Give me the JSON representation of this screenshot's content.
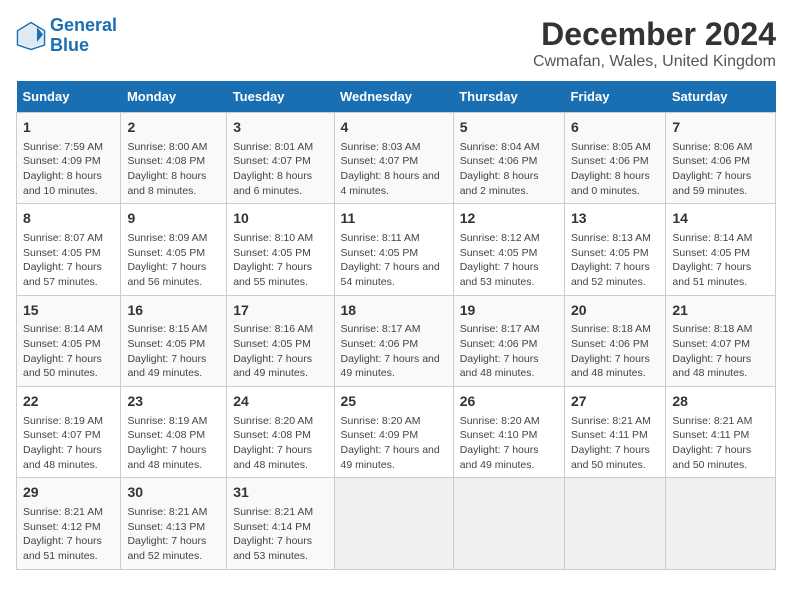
{
  "logo": {
    "line1": "General",
    "line2": "Blue"
  },
  "title": "December 2024",
  "subtitle": "Cwmafan, Wales, United Kingdom",
  "days_of_week": [
    "Sunday",
    "Monday",
    "Tuesday",
    "Wednesday",
    "Thursday",
    "Friday",
    "Saturday"
  ],
  "weeks": [
    [
      {
        "day": "1",
        "sunrise": "Sunrise: 7:59 AM",
        "sunset": "Sunset: 4:09 PM",
        "daylight": "Daylight: 8 hours and 10 minutes."
      },
      {
        "day": "2",
        "sunrise": "Sunrise: 8:00 AM",
        "sunset": "Sunset: 4:08 PM",
        "daylight": "Daylight: 8 hours and 8 minutes."
      },
      {
        "day": "3",
        "sunrise": "Sunrise: 8:01 AM",
        "sunset": "Sunset: 4:07 PM",
        "daylight": "Daylight: 8 hours and 6 minutes."
      },
      {
        "day": "4",
        "sunrise": "Sunrise: 8:03 AM",
        "sunset": "Sunset: 4:07 PM",
        "daylight": "Daylight: 8 hours and 4 minutes."
      },
      {
        "day": "5",
        "sunrise": "Sunrise: 8:04 AM",
        "sunset": "Sunset: 4:06 PM",
        "daylight": "Daylight: 8 hours and 2 minutes."
      },
      {
        "day": "6",
        "sunrise": "Sunrise: 8:05 AM",
        "sunset": "Sunset: 4:06 PM",
        "daylight": "Daylight: 8 hours and 0 minutes."
      },
      {
        "day": "7",
        "sunrise": "Sunrise: 8:06 AM",
        "sunset": "Sunset: 4:06 PM",
        "daylight": "Daylight: 7 hours and 59 minutes."
      }
    ],
    [
      {
        "day": "8",
        "sunrise": "Sunrise: 8:07 AM",
        "sunset": "Sunset: 4:05 PM",
        "daylight": "Daylight: 7 hours and 57 minutes."
      },
      {
        "day": "9",
        "sunrise": "Sunrise: 8:09 AM",
        "sunset": "Sunset: 4:05 PM",
        "daylight": "Daylight: 7 hours and 56 minutes."
      },
      {
        "day": "10",
        "sunrise": "Sunrise: 8:10 AM",
        "sunset": "Sunset: 4:05 PM",
        "daylight": "Daylight: 7 hours and 55 minutes."
      },
      {
        "day": "11",
        "sunrise": "Sunrise: 8:11 AM",
        "sunset": "Sunset: 4:05 PM",
        "daylight": "Daylight: 7 hours and 54 minutes."
      },
      {
        "day": "12",
        "sunrise": "Sunrise: 8:12 AM",
        "sunset": "Sunset: 4:05 PM",
        "daylight": "Daylight: 7 hours and 53 minutes."
      },
      {
        "day": "13",
        "sunrise": "Sunrise: 8:13 AM",
        "sunset": "Sunset: 4:05 PM",
        "daylight": "Daylight: 7 hours and 52 minutes."
      },
      {
        "day": "14",
        "sunrise": "Sunrise: 8:14 AM",
        "sunset": "Sunset: 4:05 PM",
        "daylight": "Daylight: 7 hours and 51 minutes."
      }
    ],
    [
      {
        "day": "15",
        "sunrise": "Sunrise: 8:14 AM",
        "sunset": "Sunset: 4:05 PM",
        "daylight": "Daylight: 7 hours and 50 minutes."
      },
      {
        "day": "16",
        "sunrise": "Sunrise: 8:15 AM",
        "sunset": "Sunset: 4:05 PM",
        "daylight": "Daylight: 7 hours and 49 minutes."
      },
      {
        "day": "17",
        "sunrise": "Sunrise: 8:16 AM",
        "sunset": "Sunset: 4:05 PM",
        "daylight": "Daylight: 7 hours and 49 minutes."
      },
      {
        "day": "18",
        "sunrise": "Sunrise: 8:17 AM",
        "sunset": "Sunset: 4:06 PM",
        "daylight": "Daylight: 7 hours and 49 minutes."
      },
      {
        "day": "19",
        "sunrise": "Sunrise: 8:17 AM",
        "sunset": "Sunset: 4:06 PM",
        "daylight": "Daylight: 7 hours and 48 minutes."
      },
      {
        "day": "20",
        "sunrise": "Sunrise: 8:18 AM",
        "sunset": "Sunset: 4:06 PM",
        "daylight": "Daylight: 7 hours and 48 minutes."
      },
      {
        "day": "21",
        "sunrise": "Sunrise: 8:18 AM",
        "sunset": "Sunset: 4:07 PM",
        "daylight": "Daylight: 7 hours and 48 minutes."
      }
    ],
    [
      {
        "day": "22",
        "sunrise": "Sunrise: 8:19 AM",
        "sunset": "Sunset: 4:07 PM",
        "daylight": "Daylight: 7 hours and 48 minutes."
      },
      {
        "day": "23",
        "sunrise": "Sunrise: 8:19 AM",
        "sunset": "Sunset: 4:08 PM",
        "daylight": "Daylight: 7 hours and 48 minutes."
      },
      {
        "day": "24",
        "sunrise": "Sunrise: 8:20 AM",
        "sunset": "Sunset: 4:08 PM",
        "daylight": "Daylight: 7 hours and 48 minutes."
      },
      {
        "day": "25",
        "sunrise": "Sunrise: 8:20 AM",
        "sunset": "Sunset: 4:09 PM",
        "daylight": "Daylight: 7 hours and 49 minutes."
      },
      {
        "day": "26",
        "sunrise": "Sunrise: 8:20 AM",
        "sunset": "Sunset: 4:10 PM",
        "daylight": "Daylight: 7 hours and 49 minutes."
      },
      {
        "day": "27",
        "sunrise": "Sunrise: 8:21 AM",
        "sunset": "Sunset: 4:11 PM",
        "daylight": "Daylight: 7 hours and 50 minutes."
      },
      {
        "day": "28",
        "sunrise": "Sunrise: 8:21 AM",
        "sunset": "Sunset: 4:11 PM",
        "daylight": "Daylight: 7 hours and 50 minutes."
      }
    ],
    [
      {
        "day": "29",
        "sunrise": "Sunrise: 8:21 AM",
        "sunset": "Sunset: 4:12 PM",
        "daylight": "Daylight: 7 hours and 51 minutes."
      },
      {
        "day": "30",
        "sunrise": "Sunrise: 8:21 AM",
        "sunset": "Sunset: 4:13 PM",
        "daylight": "Daylight: 7 hours and 52 minutes."
      },
      {
        "day": "31",
        "sunrise": "Sunrise: 8:21 AM",
        "sunset": "Sunset: 4:14 PM",
        "daylight": "Daylight: 7 hours and 53 minutes."
      },
      null,
      null,
      null,
      null
    ]
  ]
}
